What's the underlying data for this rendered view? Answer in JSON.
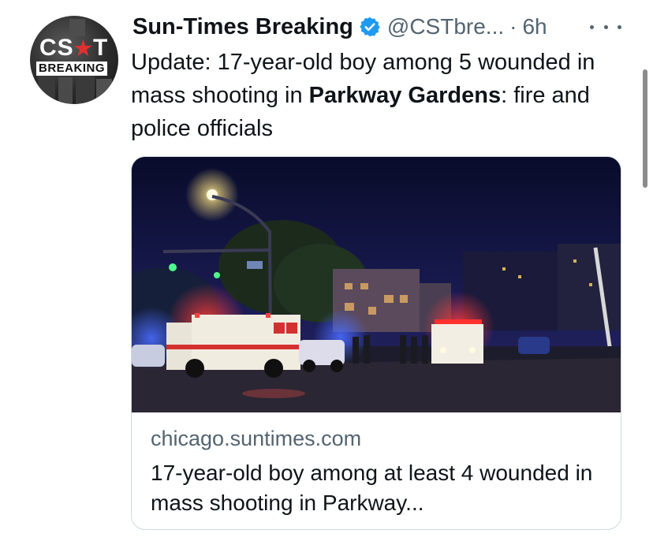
{
  "author": {
    "display_name": "Sun-Times Breaking",
    "handle": "@CSTbre...",
    "separator": "·",
    "time": "6h",
    "avatar_logo": "CS★T",
    "avatar_sub": "BREAKING"
  },
  "tweet": {
    "text_before": "Update: 17-year-old boy among 5 wounded in mass shooting in ",
    "text_bold": "Parkway Gardens",
    "text_after": ": fire and police officials"
  },
  "card": {
    "domain": "chicago.suntimes.com",
    "title": "17-year-old boy among at least 4 wounded in mass shooting in Parkway...",
    "image_alt": "ambulances-at-night-scene"
  },
  "icons": {
    "verified": "verified-badge-icon",
    "more": "more-options-icon"
  },
  "colors": {
    "text": "#0f1419",
    "secondary": "#536471",
    "verified": "#1d9bf0",
    "border": "#cfd9de"
  }
}
